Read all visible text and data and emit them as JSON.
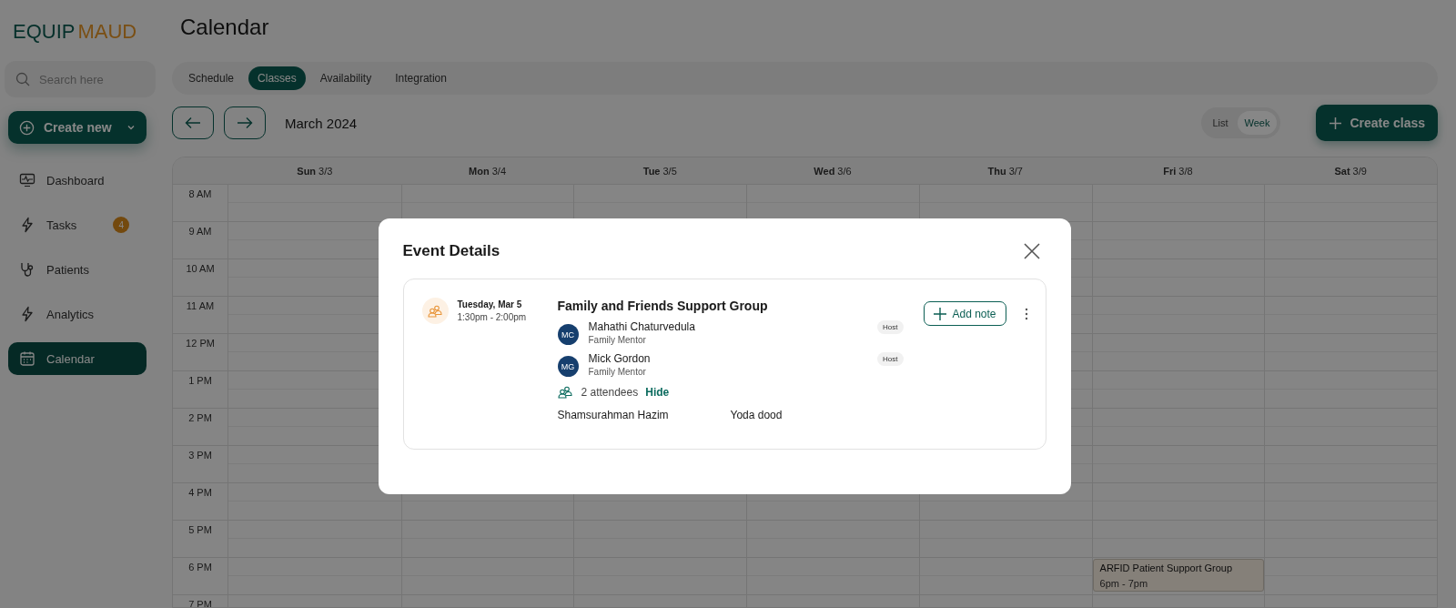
{
  "sidebar": {
    "logo": {
      "part_1": "EQUIP",
      "part_2": "MAUD"
    },
    "search": {
      "placeholder": "Search here"
    },
    "create_button": "Create new",
    "items": [
      {
        "label": "Dashboard",
        "kind": "monitor",
        "selected": false
      },
      {
        "label": "Tasks",
        "kind": "bolt",
        "selected": false,
        "badge": "4"
      },
      {
        "label": "Patients",
        "kind": "stethoscope",
        "selected": false
      },
      {
        "label": "Analytics",
        "kind": "bolt",
        "selected": false
      },
      {
        "label": "Calendar",
        "kind": "calendar",
        "selected": true
      }
    ]
  },
  "page_title": "Calendar",
  "tabs": [
    {
      "label": "Schedule",
      "selected": false
    },
    {
      "label": "Classes",
      "selected": true
    },
    {
      "label": "Availability",
      "selected": false
    },
    {
      "label": "Integration",
      "selected": false
    }
  ],
  "month": "March 2024",
  "views": [
    {
      "label": "List",
      "selected": false
    },
    {
      "label": "Week",
      "selected": true
    }
  ],
  "create_class": "Create class",
  "calendar": {
    "days": [
      {
        "day": "Sun",
        "date": "3/3"
      },
      {
        "day": "Mon",
        "date": "3/4"
      },
      {
        "day": "Tue",
        "date": "3/5"
      },
      {
        "day": "Wed",
        "date": "3/6"
      },
      {
        "day": "Thu",
        "date": "3/7"
      },
      {
        "day": "Fri",
        "date": "3/8"
      },
      {
        "day": "Sat",
        "date": "3/9"
      }
    ],
    "hours": [
      {
        "label": "8 AM"
      },
      {
        "label": "9 AM"
      },
      {
        "label": "10 AM"
      },
      {
        "label": "11 AM"
      },
      {
        "label": "12 PM"
      },
      {
        "label": "1 PM"
      },
      {
        "label": "2 PM"
      },
      {
        "label": "3 PM"
      },
      {
        "label": "4 PM"
      },
      {
        "label": "5 PM"
      },
      {
        "label": "6 PM",
        "cells": [
          {
            "booked": false
          },
          {
            "booked": false
          },
          {
            "booked": false
          },
          {
            "booked": false
          },
          {
            "booked": false
          },
          {
            "booked": true,
            "title": "ARFID Patient Support Group",
            "time": "6pm - 7pm"
          },
          {
            "booked": false
          }
        ]
      },
      {
        "label": "7 PM"
      }
    ]
  },
  "modal": {
    "title": "Event Details",
    "event": {
      "date": "Tuesday, Mar 5",
      "time": "1:30pm - 2:00pm",
      "title": "Family and Friends Support Group",
      "hosts": [
        {
          "initials": "MC",
          "name": "Mahathi Chaturvedula",
          "role": "Family Mentor",
          "badge": "Host"
        },
        {
          "initials": "MG",
          "name": "Mick Gordon",
          "role": "Family Mentor",
          "badge": "Host"
        }
      ],
      "attendee_count": "2 attendees",
      "toggle": "Hide",
      "attendees": [
        "Shamsurahman Hazim",
        "Yoda dood"
      ],
      "add_note": "Add note"
    }
  }
}
